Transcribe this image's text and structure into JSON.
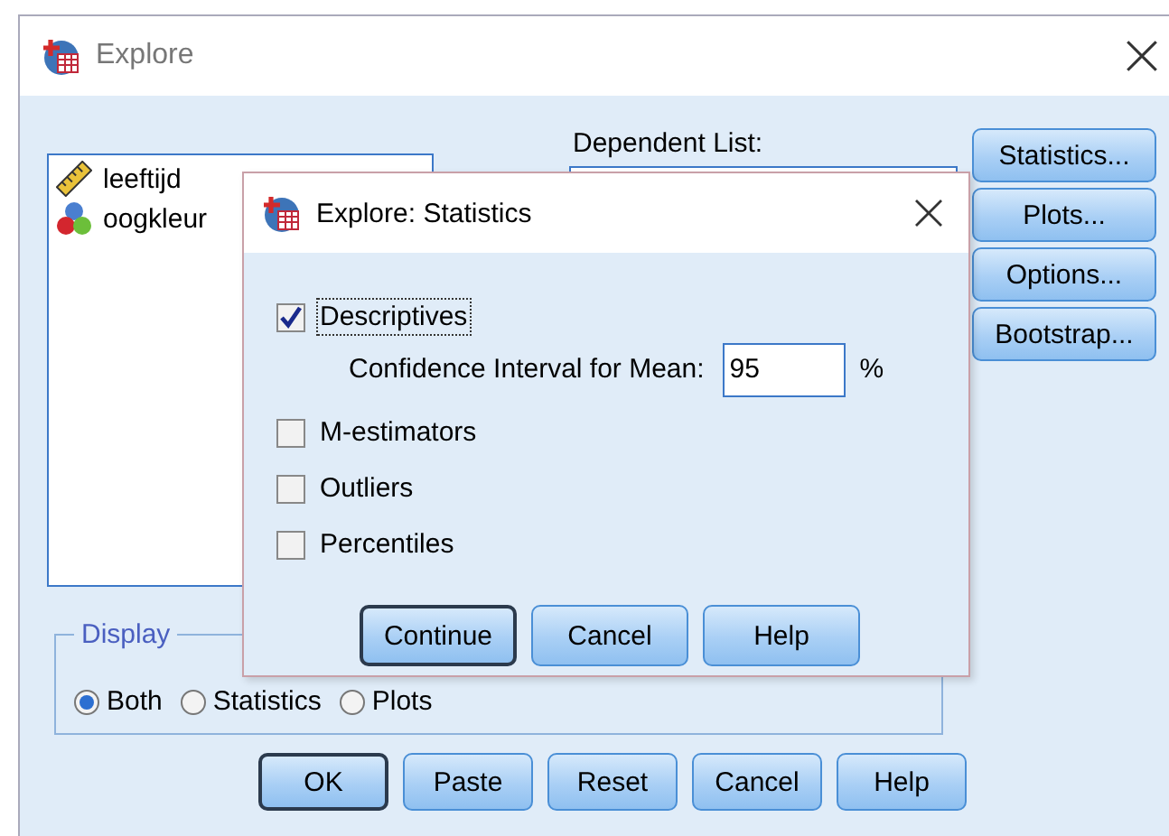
{
  "window": {
    "title": "Explore"
  },
  "variables": [
    {
      "name": "leeftijd",
      "kind": "scale"
    },
    {
      "name": "oogkleur",
      "kind": "nominal"
    }
  ],
  "dependent_list": {
    "label": "Dependent List:"
  },
  "side_buttons": [
    "Statistics...",
    "Plots...",
    "Options...",
    "Bootstrap..."
  ],
  "display": {
    "label": "Display",
    "options": [
      {
        "label": "Both",
        "selected": true
      },
      {
        "label": "Statistics",
        "selected": false
      },
      {
        "label": "Plots",
        "selected": false
      }
    ]
  },
  "buttons": [
    {
      "label": "OK",
      "default": true
    },
    {
      "label": "Paste",
      "default": false
    },
    {
      "label": "Reset",
      "default": false
    },
    {
      "label": "Cancel",
      "default": false
    },
    {
      "label": "Help",
      "default": false
    }
  ],
  "dialog": {
    "title": "Explore: Statistics",
    "options": [
      {
        "label": "Descriptives",
        "checked": true,
        "focused": true,
        "confidence": {
          "label": "Confidence Interval for Mean:",
          "value": "95",
          "unit": "%"
        }
      },
      {
        "label": "M-estimators",
        "checked": false,
        "focused": false
      },
      {
        "label": "Outliers",
        "checked": false,
        "focused": false
      },
      {
        "label": "Percentiles",
        "checked": false,
        "focused": false
      }
    ],
    "buttons": [
      {
        "label": "Continue",
        "default": true
      },
      {
        "label": "Cancel",
        "default": false
      },
      {
        "label": "Help",
        "default": false
      }
    ]
  }
}
